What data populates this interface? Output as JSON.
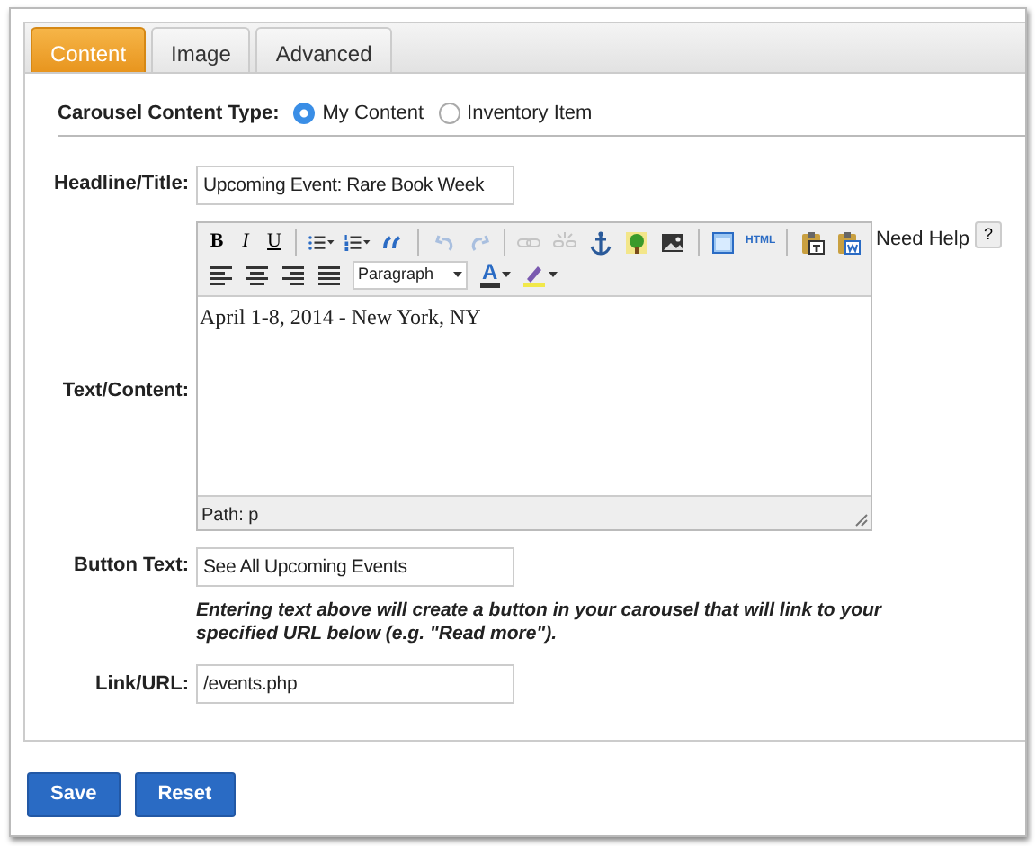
{
  "tabs": [
    {
      "label": "Content",
      "selected": true
    },
    {
      "label": "Image",
      "selected": false
    },
    {
      "label": "Advanced",
      "selected": false
    }
  ],
  "content_type": {
    "label": "Carousel Content Type:",
    "options": [
      {
        "label": "My Content",
        "selected": true
      },
      {
        "label": "Inventory Item",
        "selected": false
      }
    ]
  },
  "headline": {
    "label": "Headline/Title:",
    "value": "Upcoming Event: Rare Book Week"
  },
  "text_content": {
    "label": "Text/Content:",
    "toolbar_rows": [
      [
        {
          "kind": "text",
          "label": "B"
        },
        {
          "kind": "text",
          "label": "I"
        },
        {
          "kind": "text",
          "label": "U"
        },
        {
          "kind": "sep"
        },
        {
          "kind": "icon",
          "disabled": false,
          "dropdown": true
        },
        {
          "kind": "icon",
          "disabled": false,
          "dropdown": true
        },
        {
          "kind": "icon",
          "disabled": false,
          "dropdown": false
        },
        {
          "kind": "sep"
        },
        {
          "kind": "icon",
          "disabled": true,
          "dropdown": false
        },
        {
          "kind": "icon",
          "disabled": true,
          "dropdown": false
        },
        {
          "kind": "sep"
        },
        {
          "kind": "icon",
          "disabled": true,
          "dropdown": false
        },
        {
          "kind": "icon",
          "disabled": true,
          "dropdown": false
        },
        {
          "kind": "icon",
          "disabled": false,
          "dropdown": false
        },
        {
          "kind": "icon",
          "disabled": false,
          "dropdown": false
        },
        {
          "kind": "icon",
          "disabled": false,
          "dropdown": false
        },
        {
          "kind": "sep"
        },
        {
          "kind": "icon",
          "disabled": false,
          "dropdown": false
        },
        {
          "kind": "text",
          "label": "HTML"
        },
        {
          "kind": "sep"
        },
        {
          "kind": "icon",
          "disabled": false,
          "dropdown": false
        },
        {
          "kind": "icon",
          "disabled": false,
          "dropdown": false
        }
      ],
      [
        {
          "kind": "icon",
          "disabled": false,
          "dropdown": false
        },
        {
          "kind": "icon",
          "disabled": false,
          "dropdown": false
        },
        {
          "kind": "icon",
          "disabled": false,
          "dropdown": false
        },
        {
          "kind": "icon",
          "disabled": false,
          "dropdown": false
        },
        {
          "kind": "select",
          "label": "Paragraph"
        },
        {
          "kind": "color",
          "label": "A",
          "dropdown": true
        },
        {
          "kind": "icon",
          "disabled": false,
          "dropdown": true
        }
      ]
    ],
    "body": "April 1-8, 2014 - New York, NY",
    "path": "Path: p"
  },
  "help": {
    "label": "Need Help",
    "button": "?"
  },
  "button_text": {
    "label": "Button Text:",
    "value": "See All Upcoming Events",
    "hint": "Entering text above will create a button in your carousel that will link to your specified URL below (e.g. \"Read more\")."
  },
  "link_url": {
    "label": "Link/URL:",
    "value": "/events.php"
  },
  "buttons": [
    "Save",
    "Reset"
  ]
}
